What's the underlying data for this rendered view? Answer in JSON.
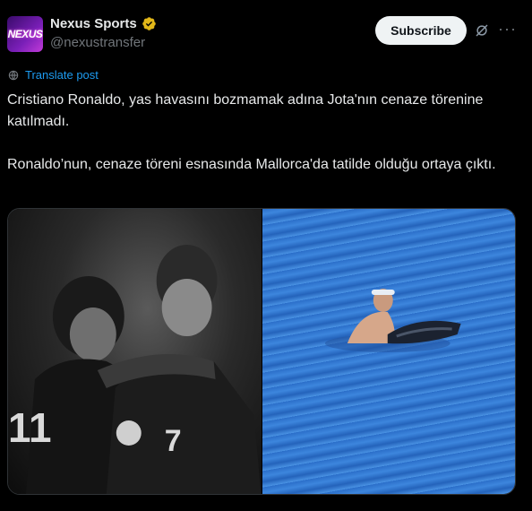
{
  "account": {
    "name": "Nexus Sports",
    "handle": "@nexustransfer",
    "avatar_text": "NEXUS",
    "verified_icon": "verified-badge-icon",
    "verified_color": "#e2b719"
  },
  "actions": {
    "subscribe_label": "Subscribe",
    "grok_icon": "grok-icon",
    "more_label": "···"
  },
  "translate": {
    "label": "Translate post",
    "icon": "translate-icon",
    "color": "#1d9bf0"
  },
  "post": {
    "paragraphs": [
      "Cristiano Ronaldo, yas havasını bozmamak adına Jota'nın cenaze törenine katılmadı.",
      "Ronaldo’nun, cenaze töreni esnasında Mallorca'da tatilde olduğu ortaya çıktı."
    ]
  },
  "media": {
    "left_image": "black-and-white photo of two football players embracing",
    "right_image": "man riding a jet ski on blue sea water"
  }
}
